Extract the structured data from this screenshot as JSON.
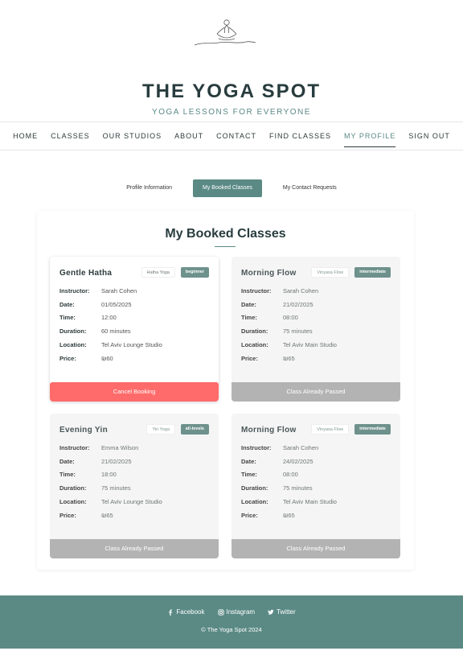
{
  "site": {
    "title": "THE YOGA SPOT",
    "tagline": "YOGA LESSONS FOR EVERYONE",
    "logo_icon": "meditation-figure-icon"
  },
  "nav": {
    "items": [
      {
        "label": "HOME"
      },
      {
        "label": "CLASSES"
      },
      {
        "label": "OUR STUDIOS"
      },
      {
        "label": "ABOUT"
      },
      {
        "label": "CONTACT"
      },
      {
        "label": "FIND CLASSES"
      },
      {
        "label": "MY PROFILE"
      },
      {
        "label": "SIGN OUT"
      }
    ],
    "active": "MY PROFILE"
  },
  "tabs": {
    "items": [
      {
        "label": "Profile Information"
      },
      {
        "label": "My Booked Classes"
      },
      {
        "label": "My Contact Requests"
      }
    ],
    "active": "My Booked Classes"
  },
  "main": {
    "heading": "My Booked Classes",
    "field_labels": {
      "instructor": "Instructor:",
      "date": "Date:",
      "time": "Time:",
      "duration": "Duration:",
      "location": "Location:",
      "price": "Price:"
    },
    "classes": [
      {
        "name": "Gentle Hatha",
        "style": "Hatha Yoga",
        "level": "beginner",
        "instructor": "Sarah Cohen",
        "date": "01/05/2025",
        "time": "12:00",
        "duration": "60 minutes",
        "location": "Tel Aviv Lounge Studio",
        "price": "₪60",
        "action": "Cancel Booking"
      },
      {
        "name": "Morning Flow",
        "style": "Vinyasa Flow",
        "level": "intermediate",
        "instructor": "Sarah Cohen",
        "date": "21/02/2025",
        "time": "08:00",
        "duration": "75 minutes",
        "location": "Tel Aviv Main Studio",
        "price": "₪65",
        "action": "Class Already Passed"
      },
      {
        "name": "Evening Yin",
        "style": "Yin Yoga",
        "level": "all-levels",
        "instructor": "Emma Wilson",
        "date": "21/02/2025",
        "time": "18:00",
        "duration": "75 minutes",
        "location": "Tel Aviv Lounge Studio",
        "price": "₪65",
        "action": "Class Already Passed"
      },
      {
        "name": "Morning Flow",
        "style": "Vinyasa Flow",
        "level": "intermediate",
        "instructor": "Sarah Cohen",
        "date": "24/02/2025",
        "time": "08:00",
        "duration": "75 minutes",
        "location": "Tel Aviv Main Studio",
        "price": "₪65",
        "action": "Class Already Passed"
      }
    ]
  },
  "footer": {
    "social": [
      {
        "label": "Facebook",
        "icon": "facebook-icon"
      },
      {
        "label": "Instagram",
        "icon": "instagram-icon"
      },
      {
        "label": "Twitter",
        "icon": "twitter-icon"
      }
    ],
    "copyright": "© The Yoga Spot 2024"
  },
  "colors": {
    "accent": "#5b8a85",
    "danger": "#ff6b6b",
    "disabled": "#b3b3b3",
    "title": "#283c3e"
  }
}
